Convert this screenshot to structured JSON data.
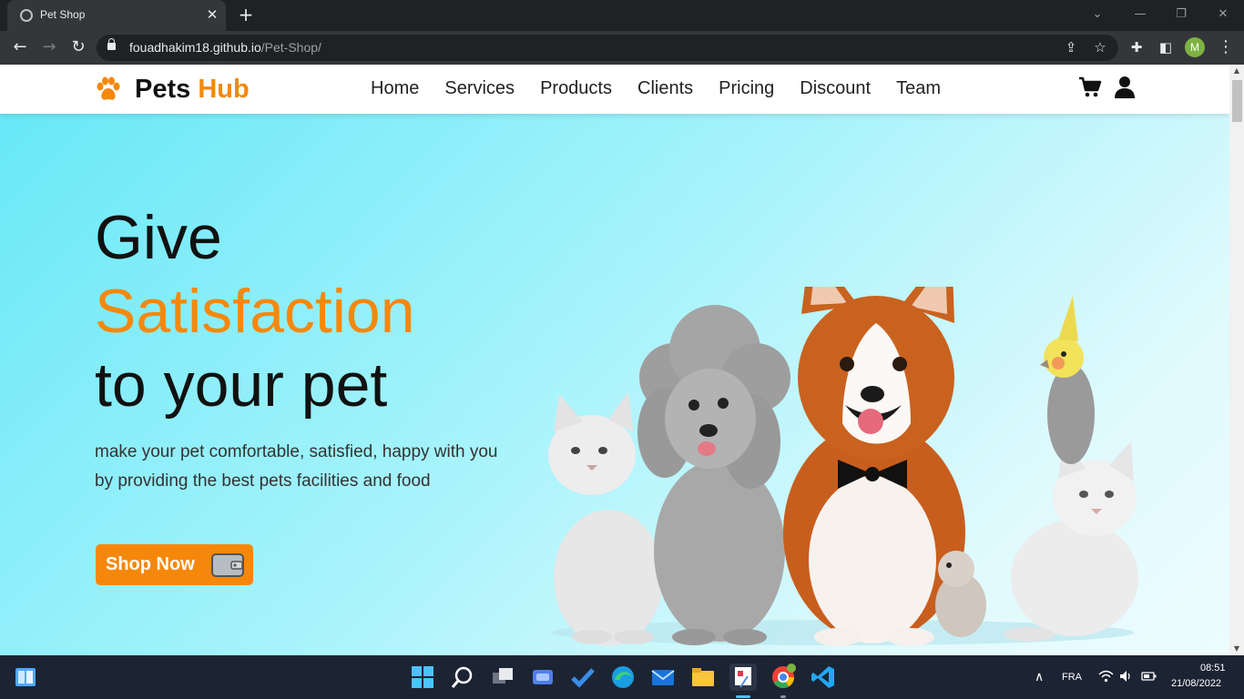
{
  "browser": {
    "tab_title": "Pet Shop",
    "tab_close": "✕",
    "new_tab": "+",
    "url_host": "fouadhakim18.github.io",
    "url_path": "/Pet-Shop/",
    "profile_initial": "M"
  },
  "site": {
    "brand": {
      "name_part1": "Pets",
      "name_part2": "Hub",
      "accent_color": "#f5880b"
    },
    "nav": {
      "links": [
        "Home",
        "Services",
        "Products",
        "Clients",
        "Pricing",
        "Discount",
        "Team"
      ],
      "cart_icon": "cart-icon",
      "user_icon": "user-icon"
    },
    "hero": {
      "title_line1": "Give",
      "title_line2": "Satisfaction",
      "title_line3": "to your pet",
      "subtitle": "make your pet comfortable, satisfied, happy with you by providing the best pets facilities and food",
      "cta_label": "Shop Now",
      "cta_icon": "wallet-icon",
      "image_alt": "pets-group-image"
    }
  },
  "taskbar": {
    "language": "FRA",
    "time": "08:51",
    "date": "21/08/2022"
  }
}
